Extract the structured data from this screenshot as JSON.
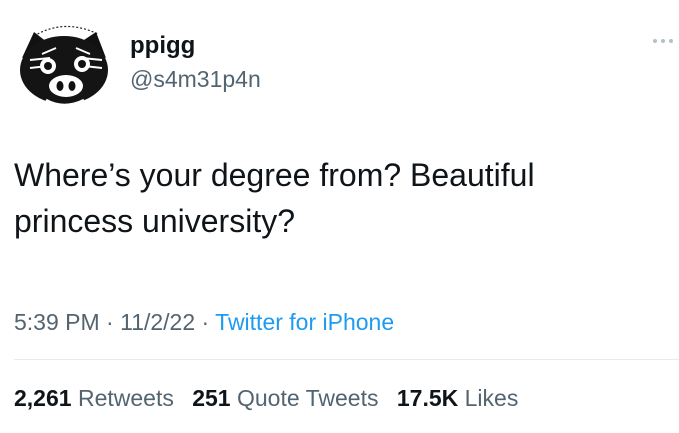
{
  "author": {
    "display_name": "ppigg",
    "handle": "@s4m31p4n",
    "avatar_icon": "pig-face-avatar",
    "avatar_text": "ppigg"
  },
  "tweet": {
    "text_line1": "Where’s your degree from? Beautiful",
    "text_line2": "princess university?"
  },
  "meta": {
    "time": "5:39 PM",
    "sep1": " · ",
    "date": "11/2/22",
    "sep2": " · ",
    "source": "Twitter for iPhone"
  },
  "stats": {
    "retweets_count": "2,261",
    "retweets_label": "Retweets",
    "quotes_count": "251",
    "quotes_label": "Quote Tweets",
    "likes_count": "17.5K",
    "likes_label": "Likes"
  },
  "colors": {
    "text": "#0f1419",
    "secondary": "#536471",
    "link": "#1d9bf0",
    "divider": "#e6ecf0"
  }
}
